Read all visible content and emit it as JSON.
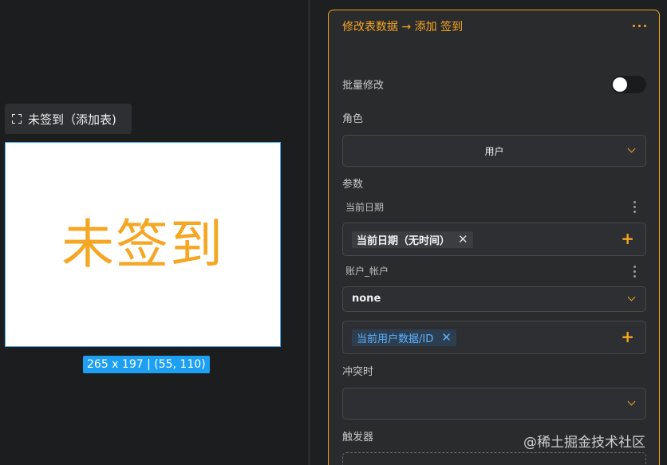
{
  "canvas": {
    "component_tag": "未签到（添加表)",
    "component_text": "未签到",
    "size_badge": "265 x 197 | (55, 110)"
  },
  "panel": {
    "title": "修改表数据 → 添加 签到",
    "batch_edit_label": "批量修改",
    "batch_edit_enabled": false,
    "role_label": "角色",
    "role_value": "用户",
    "params_label": "参数",
    "param1_label": "当前日期",
    "param1_chip": "当前日期（无时间）",
    "param2_label": "账户_帐户",
    "param2_select": "none",
    "param2_chip": "当前用户数据/ID",
    "conflict_label": "冲突时",
    "conflict_value": "",
    "trigger_label": "触发器"
  },
  "watermark": "@稀土掘金技术社区",
  "colors": {
    "accent": "#f5a623",
    "selection": "#1ea0f2",
    "chip_blue": "#5db3ff"
  }
}
